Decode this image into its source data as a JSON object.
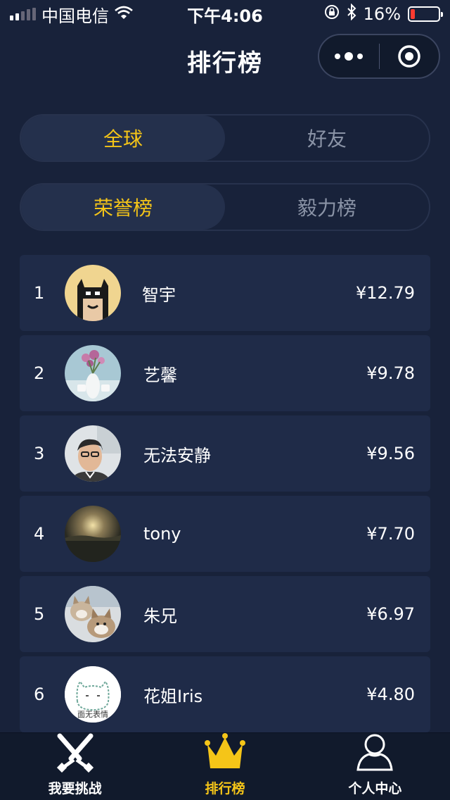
{
  "status_bar": {
    "carrier": "中国电信",
    "time": "下午4:06",
    "battery": "16%",
    "battery_level": 0.16
  },
  "nav": {
    "title": "排行榜",
    "more_icon": "more-dots-icon",
    "close_icon": "target-circle-icon"
  },
  "scope_tabs": [
    {
      "label": "全球",
      "active": true
    },
    {
      "label": "好友",
      "active": false
    }
  ],
  "board_tabs": [
    {
      "label": "荣誉榜",
      "active": true
    },
    {
      "label": "毅力榜",
      "active": false
    }
  ],
  "ranking": [
    {
      "rank": "1",
      "name": "智宇",
      "amount": "¥12.79",
      "avatar": "batman-avatar"
    },
    {
      "rank": "2",
      "name": "艺馨",
      "amount": "¥9.78",
      "avatar": "flower-vase-avatar"
    },
    {
      "rank": "3",
      "name": "无法安静",
      "amount": "¥9.56",
      "avatar": "selfie-avatar"
    },
    {
      "rank": "4",
      "name": "tony",
      "amount": "¥7.70",
      "avatar": "sunset-avatar"
    },
    {
      "rank": "5",
      "name": "朱兄",
      "amount": "¥6.97",
      "avatar": "husky-dogs-avatar"
    },
    {
      "rank": "6",
      "name": "花姐Iris",
      "amount": "¥4.80",
      "avatar": "cat-sketch-avatar",
      "avatar_text": "面无表情"
    }
  ],
  "tabbar": [
    {
      "label": "我要挑战",
      "icon": "crossed-swords-icon",
      "active": false
    },
    {
      "label": "排行榜",
      "icon": "crown-icon",
      "active": true
    },
    {
      "label": "个人中心",
      "icon": "user-icon",
      "active": false
    }
  ],
  "colors": {
    "background": "#18223a",
    "card": "#1f2b48",
    "accent": "#f5c518"
  }
}
